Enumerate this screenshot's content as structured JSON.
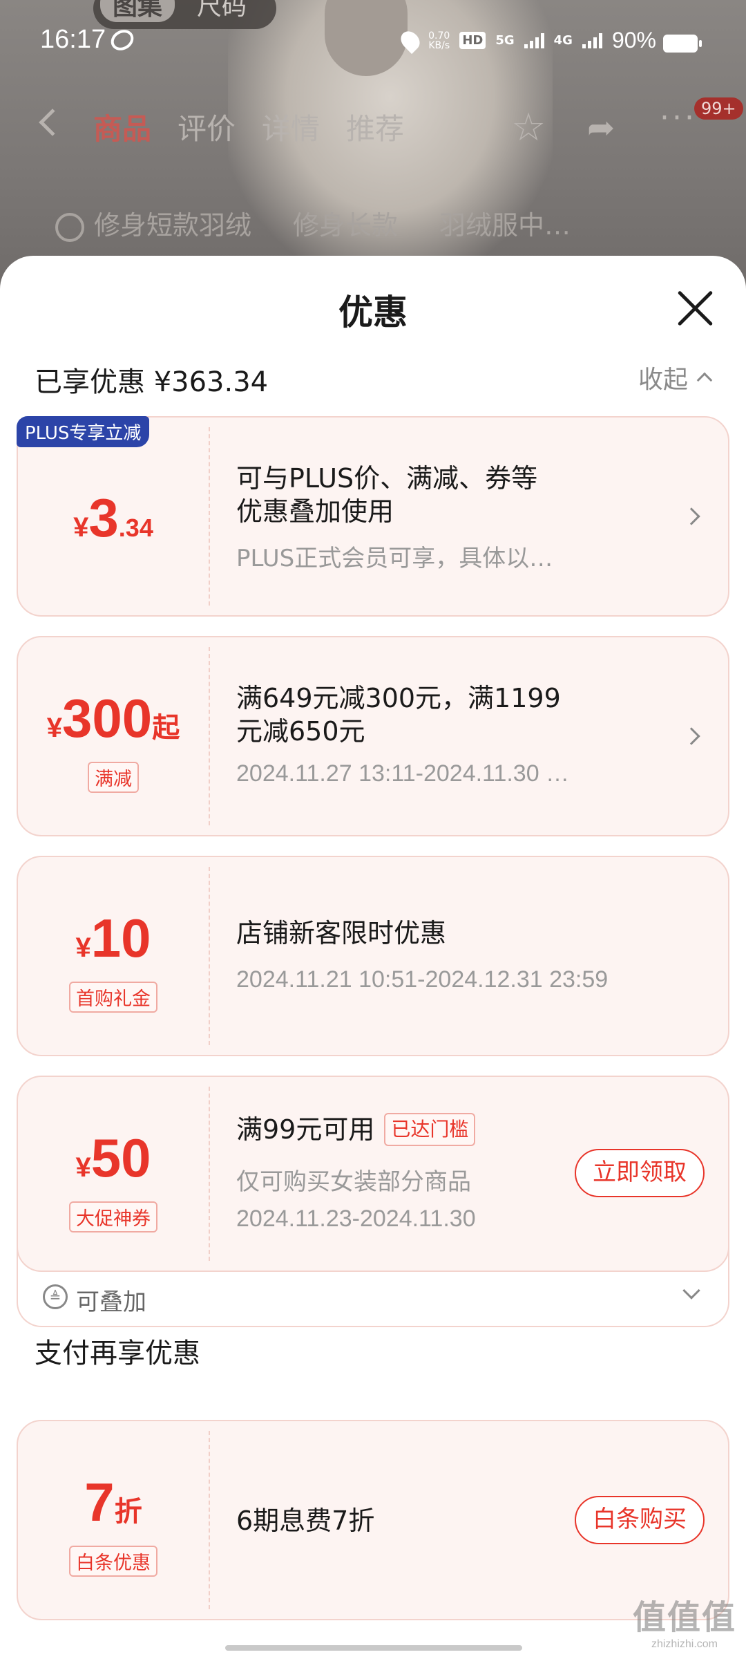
{
  "background": {
    "media_tabs": [
      "图集",
      "尺码"
    ],
    "nav_tabs": [
      "商品",
      "评价",
      "详情",
      "推荐"
    ],
    "cart_badge": "99+",
    "variants": [
      "修身短款羽绒",
      "修身长款",
      "羽绒服中…"
    ]
  },
  "status_bar": {
    "time": "16:17",
    "net_speed": "0.70",
    "net_unit": "KB/s",
    "hd": "HD",
    "net1": "5G",
    "net2": "4G",
    "battery": "90%"
  },
  "sheet": {
    "title": "优惠",
    "summary": "已享优惠 ¥363.34",
    "collapse_label": "收起"
  },
  "coupons": [
    {
      "badge": "PLUS专享立减",
      "symbol": "¥",
      "amount_int": "3",
      "amount_dec": ".34",
      "title_line1": "可与PLUS价、满减、券等",
      "title_line2": "优惠叠加使用",
      "subtitle": "PLUS正式会员可享，具体以…"
    },
    {
      "symbol": "¥",
      "amount_int": "300",
      "amount_suffix": "起",
      "tag": "满减",
      "title_line1": "满649元减300元，满1199",
      "title_line2": "元减650元",
      "subtitle": "2024.11.27 13:11-2024.11.30 …"
    },
    {
      "symbol": "¥",
      "amount_int": "10",
      "tag": "首购礼金",
      "title": "店铺新客限时优惠",
      "subtitle": "2024.11.21 10:51-2024.12.31 23:59"
    },
    {
      "symbol": "¥",
      "amount_int": "50",
      "tag": "大促神券",
      "title": "满99元可用",
      "reached": "已达门槛",
      "scope": "仅可购买女装部分商品",
      "subtitle": "2024.11.23-2024.11.30",
      "action": "立即领取",
      "stackable": "可叠加"
    }
  ],
  "payment": {
    "section_title": "支付再享优惠",
    "amount_int": "7",
    "amount_suffix": "折",
    "tag": "白条优惠",
    "title": "6期息费7折",
    "action": "白条购买"
  },
  "watermark": {
    "big": "值值值",
    "small": "zhizhizhi.com"
  },
  "colors": {
    "accent": "#e8352a",
    "card_bg": "#fdf4f2",
    "card_border": "#f3d3cd",
    "plus_badge": "#2c44a8"
  }
}
